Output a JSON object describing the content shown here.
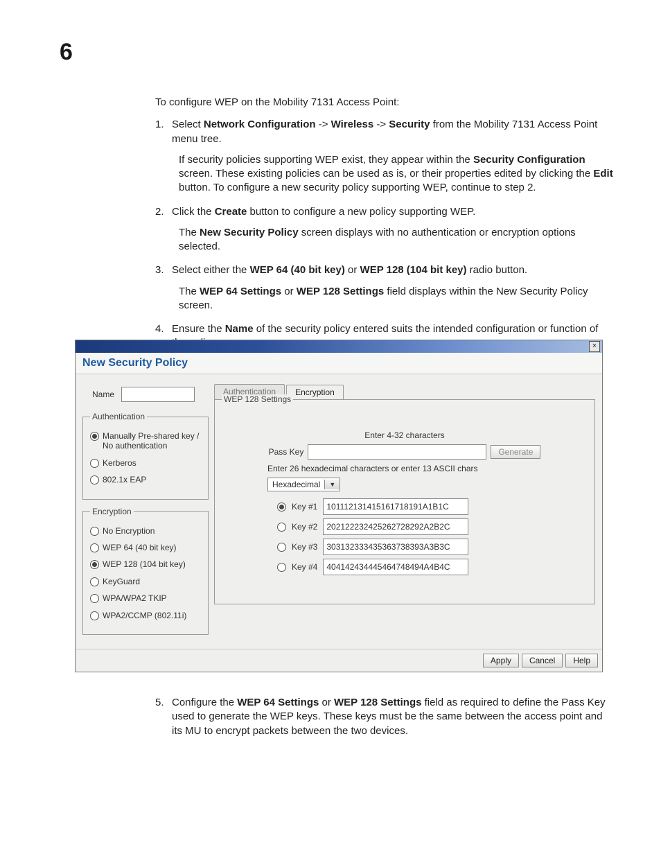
{
  "page_number": "6",
  "intro": "To configure WEP on the Mobility 7131 Access Point:",
  "steps": [
    {
      "num": "1.",
      "prefix": "Select ",
      "bold1": "Network Configuration",
      "mid1": " -> ",
      "bold2": "Wireless",
      "mid2": " -> ",
      "bold3": "Security",
      "suffix": " from the Mobility 7131 Access Point menu tree.",
      "nested_parts": {
        "p1": "If security policies supporting WEP exist, they appear within the ",
        "b1": "Security Configuration",
        "p2": " screen. These existing policies can be used as is, or their properties edited by clicking the ",
        "b2": "Edit",
        "p3": " button. To configure a new security policy supporting WEP, continue to step 2."
      }
    },
    {
      "num": "2.",
      "prefix": "Click the ",
      "bold1": "Create",
      "suffix": " button to configure a new policy supporting WEP.",
      "nested_parts": {
        "p1": "The ",
        "b1": "New Security Policy",
        "p2": " screen displays with no authentication or encryption options selected."
      }
    },
    {
      "num": "3.",
      "prefix": "Select either the ",
      "bold1": "WEP 64 (40 bit key)",
      "mid1": " or ",
      "bold2": "WEP 128 (104 bit key)",
      "suffix": " radio button.",
      "nested_parts": {
        "p1": "The ",
        "b1": "WEP 64 Settings",
        "p2": " or ",
        "b2": "WEP 128 Settings",
        "p3": " field displays within the New Security Policy screen."
      }
    },
    {
      "num": "4.",
      "prefix": "Ensure the ",
      "bold1": "Name",
      "suffix": " of the security policy entered suits the intended configuration or function of the policy."
    }
  ],
  "step5": {
    "num": "5.",
    "prefix": "Configure the ",
    "bold1": "WEP 64 Settings",
    "mid1": " or ",
    "bold2": "WEP 128 Settings",
    "suffix": " field as required to define the Pass Key used to generate the WEP keys. These keys must be the same between the access point and its MU to encrypt packets between the two devices."
  },
  "dialog": {
    "close": "×",
    "heading": "New Security Policy",
    "name_label": "Name",
    "auth_legend": "Authentication",
    "auth_items": [
      "Manually Pre-shared key / No authentication",
      "Kerberos",
      "802.1x EAP"
    ],
    "enc_legend": "Encryption",
    "enc_items": [
      "No Encryption",
      "WEP 64 (40 bit key)",
      "WEP 128 (104 bit key)",
      "KeyGuard",
      "WPA/WPA2 TKIP",
      "WPA2/CCMP (802.11i)"
    ],
    "tab_auth": "Authentication",
    "tab_enc": "Encryption",
    "wep_legend": "WEP  128 Settings",
    "chars_note": "Enter 4-32 characters",
    "passkey_label": "Pass Key",
    "generate": "Generate",
    "hex_note": "Enter 26 hexadecimal characters or enter 13 ASCII chars",
    "format_select": "Hexadecimal",
    "keys": [
      {
        "label": "Key #1",
        "value": "101112131415161718191A1B1C"
      },
      {
        "label": "Key #2",
        "value": "202122232425262728292A2B2C"
      },
      {
        "label": "Key #3",
        "value": "303132333435363738393A3B3C"
      },
      {
        "label": "Key #4",
        "value": "404142434445464748494A4B4C"
      }
    ],
    "footer": {
      "apply": "Apply",
      "cancel": "Cancel",
      "help": "Help"
    }
  }
}
